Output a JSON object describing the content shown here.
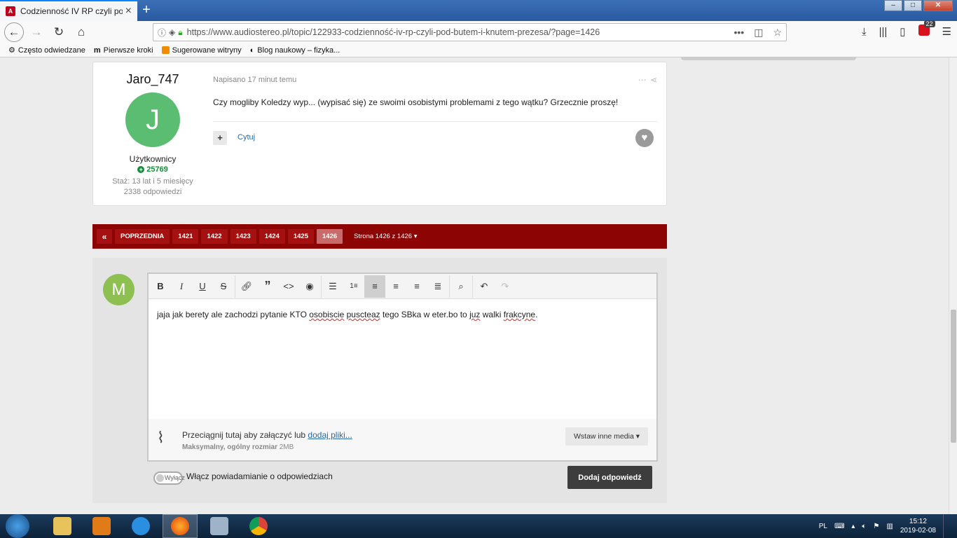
{
  "browser": {
    "tab_title": "Codzienność IV RP czyli pod bu",
    "url": "https://www.audiostereo.pl/topic/122933-codzienność-iv-rp-czyli-pod-butem-i-knutem-prezesa/?page=1426",
    "notification_count": "22",
    "bookmarks": [
      {
        "label": "Często odwiedzane"
      },
      {
        "label": "Pierwsze kroki"
      },
      {
        "label": "Sugerowane witryny"
      },
      {
        "label": "Blog naukowy – fizyka..."
      }
    ]
  },
  "post": {
    "author_name": "Jaro_747",
    "avatar_letter": "J",
    "group": "Użytkownicy",
    "reputation": "25769",
    "tenure": "Staż: 13 lat i 5 miesięcy",
    "replies": "2338 odpowiedzi",
    "posted": "Napisano 17 minut temu",
    "content": "Czy mogliby Koledzy wyp... (wypisać się) ze swoimi osobistymi problemami z tego wątku? Grzecznie proszę!",
    "quote_label": "Cytuj"
  },
  "pagination": {
    "prev_label": "POPRZEDNIA",
    "pages": [
      "1421",
      "1422",
      "1423",
      "1424",
      "1425",
      "1426"
    ],
    "current": "1426",
    "page_of": "Strona 1426 z 1426"
  },
  "reply": {
    "avatar_letter": "M",
    "editor_text_parts": [
      "jaja jak berety ale zachodzi pytanie KTO ",
      "osobiscie",
      " ",
      "puscteaz",
      " tego SBka w eter.bo to ",
      "juz",
      " walki ",
      "frakcyne",
      "."
    ],
    "attach_text": "Przeciągnij tutaj aby załączyć lub ",
    "attach_link": "dodaj pliki...",
    "max_size_label": "Maksymalny, ogólny rozmiar",
    "max_size_value": "2MB",
    "insert_media": "Wstaw inne media",
    "toggle_label": "Wyłącz",
    "notify_label": "Włącz powiadamianie o odpowiedziach",
    "submit_label": "Dodaj odpowiedź"
  },
  "taskbar": {
    "lang": "PL",
    "time": "15:12",
    "date": "2019-02-08"
  },
  "colors": {
    "pagination_bg": "#8c0404",
    "accent_link": "#2b6aa6",
    "avatar_j": "#5bbd72",
    "avatar_m": "#8dc050"
  }
}
